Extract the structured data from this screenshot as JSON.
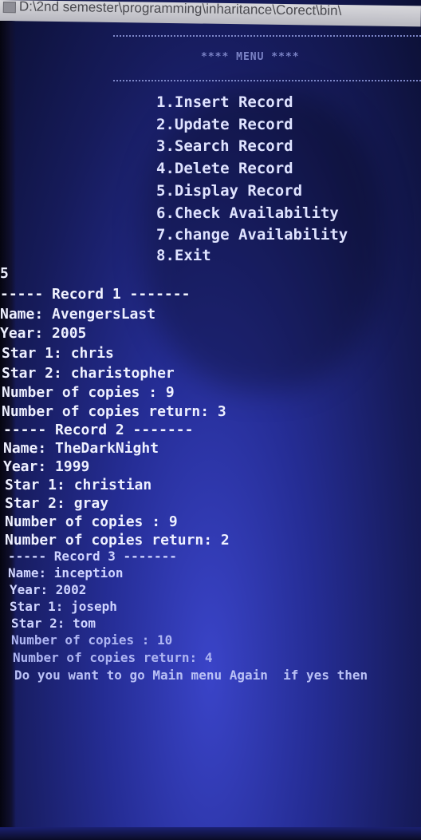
{
  "window": {
    "title": "D:\\2nd semester\\programming\\inharitance\\Corect\\bin\\"
  },
  "menu": {
    "title": "**** MENU ****",
    "items": [
      "1.Insert Record",
      "2.Update Record",
      "3.Search Record",
      "4.Delete Record",
      "5.Display Record",
      "6.Check Availability",
      "7.change Availability",
      "8.Exit"
    ]
  },
  "input_echo": "5",
  "records": [
    {
      "header": "----- Record 1 -------",
      "name": "Name: AvengersLast",
      "year": "Year: 2005",
      "star1": "Star 1: chris",
      "star2": "Star 2: charistopher",
      "copies": "Number of copies : 9",
      "returned": "Number of copies return: 3"
    },
    {
      "header": "----- Record 2 -------",
      "name": "Name: TheDarkNight",
      "year": "Year: 1999",
      "star1": "Star 1: christian",
      "star2": "Star 2: gray",
      "copies": "Number of copies : 9",
      "returned": "Number of copies return: 2"
    },
    {
      "header": "----- Record 3 -------",
      "name": "Name: inception",
      "year": "Year: 2002",
      "star1": "Star 1: joseph",
      "star2": "Star 2: tom",
      "copies": "Number of copies : 10",
      "returned": "Number of copies return: 4"
    }
  ],
  "prompt": "Do you want to go Main menu Again  if yes then",
  "colors": {
    "console_bg": "#252d95",
    "console_text": "#e6e8ff",
    "titlebar_bg": "#c8c8ce"
  }
}
